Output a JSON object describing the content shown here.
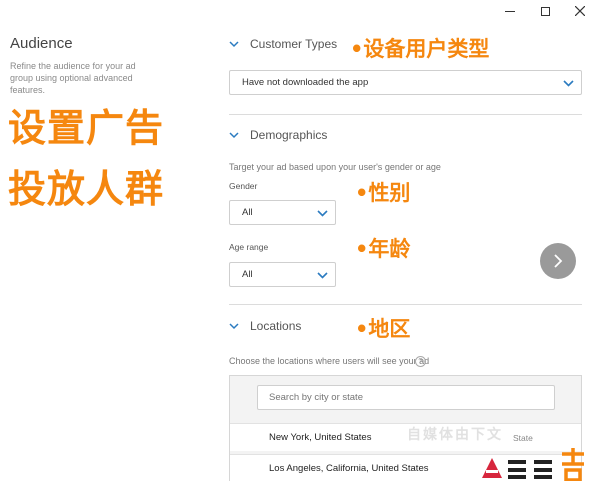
{
  "window": {
    "buttons": [
      "minimize",
      "maximize",
      "close"
    ]
  },
  "sidebar": {
    "title": "Audience",
    "description": "Refine the audience for your ad group using optional advanced features."
  },
  "annotations": {
    "main_line1": "设置广告",
    "main_line2": "投放人群",
    "customer_types": "•设备用户类型",
    "gender": "•性别",
    "age": "•年龄",
    "locations": "•地区",
    "color": "#f5870f"
  },
  "sections": {
    "customer_types": {
      "heading": "Customer Types",
      "selected": "Have not downloaded the app"
    },
    "demographics": {
      "heading": "Demographics",
      "description": "Target your ad based upon your user's gender or age",
      "gender_label": "Gender",
      "gender_value": "All",
      "age_label": "Age range",
      "age_value": "All"
    },
    "locations": {
      "heading": "Locations",
      "description": "Choose the locations where users will see your ad",
      "help_glyph": "?",
      "search_placeholder": "Search by city or state",
      "results": [
        {
          "name": "New York, United States",
          "type": "State"
        },
        {
          "name": "Los Angeles, California, United States",
          "type": ""
        }
      ]
    }
  },
  "watermark": {
    "text": "自媒体由下文"
  },
  "colors": {
    "accent_blue": "#2b7bc0",
    "next_button": "#9a9a9a",
    "divider": "#dcdcdc"
  }
}
